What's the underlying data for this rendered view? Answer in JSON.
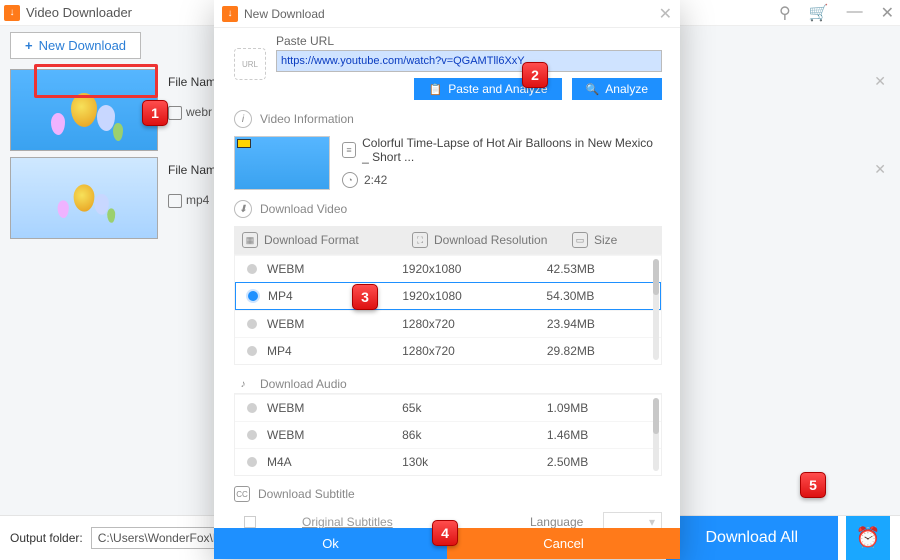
{
  "app": {
    "title": "Video Downloader"
  },
  "toolbar": {
    "new_download": "New Download"
  },
  "jobs": [
    {
      "file_name_label": "File Nam",
      "format_label": "webr"
    },
    {
      "file_name_label": "File Nam",
      "format_label": "mp4"
    }
  ],
  "footer": {
    "output_label": "Output folder:",
    "output_path": "C:\\Users\\WonderFox\\Deskt",
    "download_all": "Download All"
  },
  "modal": {
    "title": "New Download",
    "url_label": "Paste URL",
    "url_value": "https://www.youtube.com/watch?v=QGAMTll6XxY",
    "paste_analyze": "Paste and Analyze",
    "analyze": "Analyze",
    "video_info_label": "Video Information",
    "video_title": "Colorful Time-Lapse of Hot Air Balloons in New Mexico _ Short ...",
    "duration": "2:42",
    "download_video_label": "Download Video",
    "cols": {
      "format": "Download Format",
      "resolution": "Download Resolution",
      "size": "Size"
    },
    "video_rows": [
      {
        "format": "WEBM",
        "resolution": "1920x1080",
        "size": "42.53MB",
        "selected": false
      },
      {
        "format": "MP4",
        "resolution": "1920x1080",
        "size": "54.30MB",
        "selected": true
      },
      {
        "format": "WEBM",
        "resolution": "1280x720",
        "size": "23.94MB",
        "selected": false
      },
      {
        "format": "MP4",
        "resolution": "1280x720",
        "size": "29.82MB",
        "selected": false
      }
    ],
    "download_audio_label": "Download Audio",
    "audio_rows": [
      {
        "format": "WEBM",
        "bitrate": "65k",
        "size": "1.09MB"
      },
      {
        "format": "WEBM",
        "bitrate": "86k",
        "size": "1.46MB"
      },
      {
        "format": "M4A",
        "bitrate": "130k",
        "size": "2.50MB"
      }
    ],
    "download_subtitle_label": "Download Subtitle",
    "original_subtitles": "Original Subtitles",
    "language_label": "Language",
    "ok": "Ok",
    "cancel": "Cancel"
  },
  "callouts": {
    "1": "1",
    "2": "2",
    "3": "3",
    "4": "4",
    "5": "5"
  }
}
